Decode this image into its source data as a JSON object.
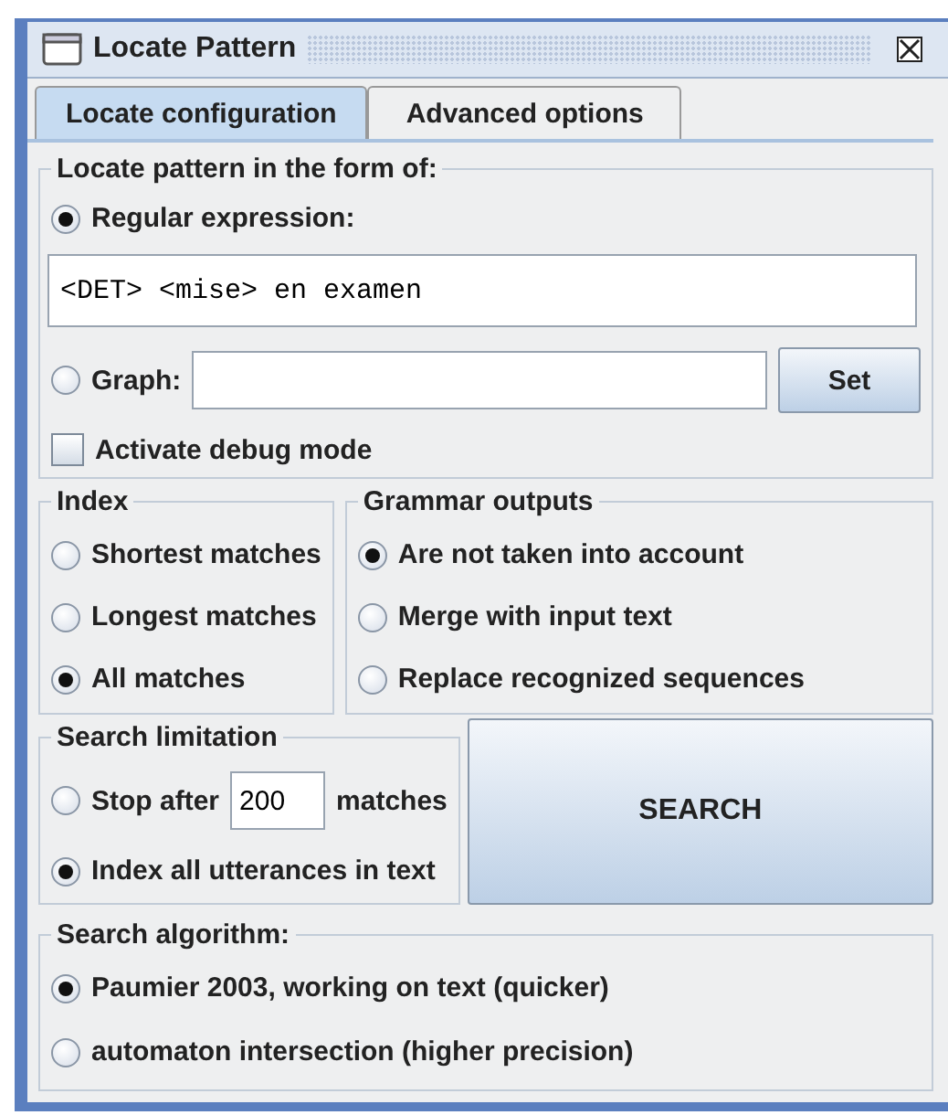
{
  "window": {
    "title": "Locate Pattern"
  },
  "tabs": [
    {
      "label": "Locate configuration",
      "selected": true
    },
    {
      "label": "Advanced options",
      "selected": false
    }
  ],
  "locate_pattern": {
    "title": "Locate pattern in the form of:",
    "options": [
      {
        "kind": "regex",
        "label": "Regular expression:",
        "selected": true,
        "value": "<DET> <mise> en examen"
      },
      {
        "kind": "graph",
        "label": "Graph:",
        "selected": false
      }
    ],
    "set_button": "Set",
    "debug": {
      "label": "Activate debug mode",
      "checked": false
    }
  },
  "index": {
    "title": "Index",
    "options": [
      {
        "label": "Shortest matches",
        "selected": false
      },
      {
        "label": "Longest matches",
        "selected": false
      },
      {
        "label": "All matches",
        "selected": true
      }
    ]
  },
  "grammar_outputs": {
    "title": "Grammar outputs",
    "options": [
      {
        "label": "Are not taken into account",
        "selected": true
      },
      {
        "label": "Merge with input text",
        "selected": false
      },
      {
        "label": "Replace recognized sequences",
        "selected": false
      }
    ]
  },
  "search_limitation": {
    "title": "Search limitation",
    "options": [
      {
        "kind": "stop",
        "label": "Stop after",
        "value": "200",
        "suffix": "matches",
        "selected": false
      },
      {
        "kind": "all",
        "label": "Index all utterances in text",
        "selected": true
      }
    ]
  },
  "search_button": "SEARCH",
  "search_algorithm": {
    "title": "Search algorithm:",
    "options": [
      {
        "label": "Paumier 2003, working on text (quicker)",
        "selected": true
      },
      {
        "label": "automaton intersection (higher precision)",
        "selected": false
      }
    ]
  }
}
